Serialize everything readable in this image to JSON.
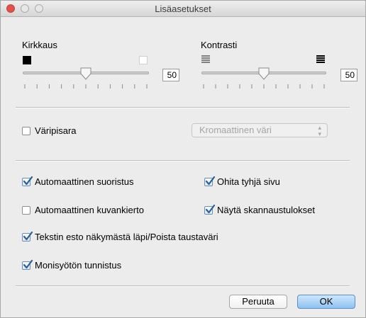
{
  "window": {
    "title": "Lisäasetukset"
  },
  "brightness": {
    "label": "Kirkkaus",
    "value": "50",
    "level": 0.5
  },
  "contrast": {
    "label": "Kontrasti",
    "value": "50",
    "level": 0.5
  },
  "color_dropout": {
    "label": "Väripisara",
    "checked": false,
    "select_value": "Kromaattinen väri"
  },
  "options": {
    "auto_deskew": {
      "label": "Automaattinen suoristus",
      "checked": true
    },
    "skip_blank_page": {
      "label": "Ohita tyhjä sivu",
      "checked": true
    },
    "auto_rotate": {
      "label": "Automaattinen kuvankierto",
      "checked": false
    },
    "show_scan_results": {
      "label": "Näytä skannaustulokset",
      "checked": true
    },
    "bleed_through": {
      "label": "Tekstin esto näkymästä läpi/Poista taustaväri",
      "checked": true
    },
    "multifeed_detect": {
      "label": "Monisyötön tunnistus",
      "checked": true
    }
  },
  "buttons": {
    "cancel": "Peruuta",
    "ok": "OK"
  },
  "colors": {
    "close_button": "#e0534c",
    "checkmark": "#2d5e96",
    "ok_button": "#8fc2f1"
  },
  "icons": {
    "brightness_low": "black-square-icon",
    "brightness_high": "white-square-icon",
    "contrast_low": "contrast-low-icon",
    "contrast_high": "contrast-high-icon",
    "select_arrows": "up-down-arrows-icon"
  }
}
